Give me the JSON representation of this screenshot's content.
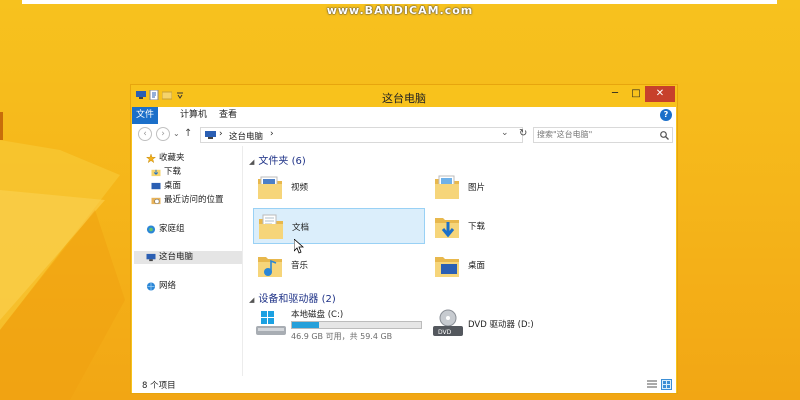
{
  "watermark": "www.BANDICAM.com",
  "window": {
    "title": "这台电脑",
    "controls": {
      "minimize": "─",
      "maximize": "□",
      "close": "✕"
    }
  },
  "ribbon": {
    "tabs": [
      "文件",
      "计算机",
      "查看"
    ],
    "help": "?"
  },
  "address": {
    "back": "‹",
    "forward": "›",
    "up": "↑",
    "path_root_sep": "›",
    "path": "这台电脑",
    "path_sep": "›",
    "dropdown": "⌄",
    "refresh": "↻",
    "search_placeholder": "搜索\"这台电脑\"",
    "search_icon": "search-icon"
  },
  "nav": {
    "items": [
      {
        "label": "收藏夹",
        "icon": "star-icon"
      },
      {
        "label": "下载",
        "icon": "download-folder-icon"
      },
      {
        "label": "桌面",
        "icon": "desktop-icon"
      },
      {
        "label": "最近访问的位置",
        "icon": "recent-places-icon"
      },
      {
        "label": "家庭组",
        "icon": "homegroup-icon"
      },
      {
        "label": "这台电脑",
        "icon": "computer-icon"
      },
      {
        "label": "网络",
        "icon": "network-icon"
      }
    ]
  },
  "groups": {
    "folders": "文件夹 (6)",
    "devices": "设备和驱动器 (2)",
    "expanded_glyph": "◢"
  },
  "folders": [
    {
      "label": "视频",
      "icon": "videos-folder-icon"
    },
    {
      "label": "图片",
      "icon": "pictures-folder-icon"
    },
    {
      "label": "文档",
      "icon": "documents-folder-icon"
    },
    {
      "label": "下载",
      "icon": "downloads-folder-icon"
    },
    {
      "label": "音乐",
      "icon": "music-folder-icon"
    },
    {
      "label": "桌面",
      "icon": "desktop-folder-icon"
    }
  ],
  "drives": [
    {
      "name": "本地磁盘 (C:)",
      "size": "46.9 GB 可用，共 59.4 GB",
      "used_fraction": 0.21,
      "icon": "windows-drive-icon"
    },
    {
      "name": "DVD 驱动器 (D:)",
      "icon": "dvd-drive-icon"
    }
  ],
  "status": {
    "count": "8 个项目"
  },
  "colors": {
    "accent": "#1b6fc9",
    "titlebar": "#f8c21c",
    "selection": "#dbeefb"
  }
}
